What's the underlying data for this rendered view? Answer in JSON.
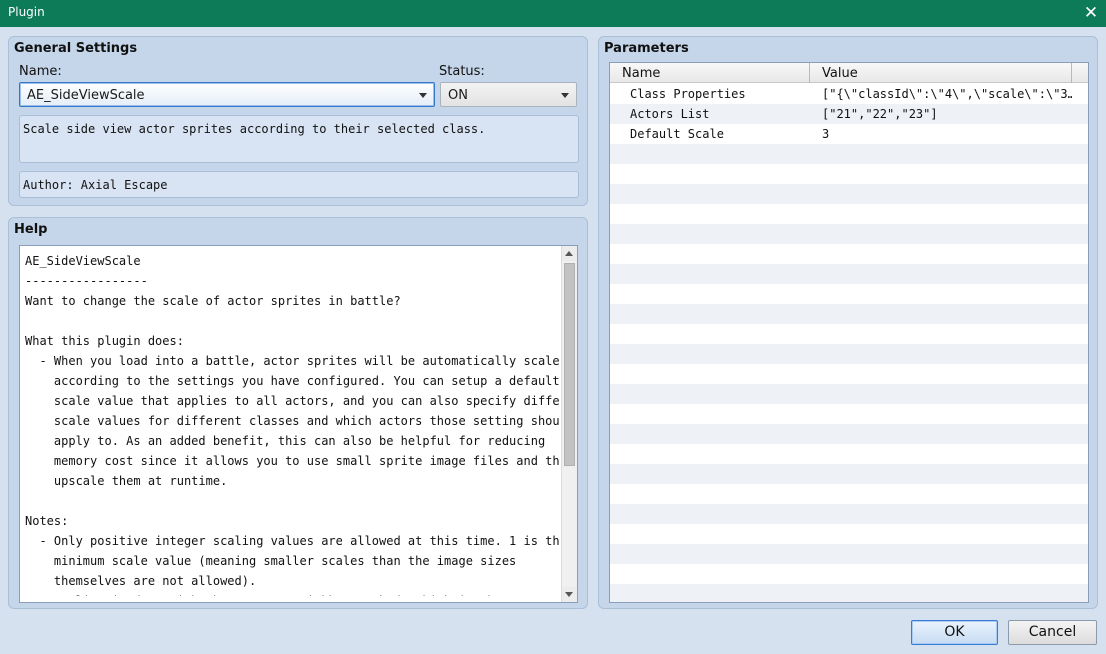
{
  "window": {
    "title": "Plugin"
  },
  "general": {
    "title": "General Settings",
    "name_label": "Name:",
    "name_value": "AE_SideViewScale",
    "status_label": "Status:",
    "status_value": "ON",
    "description": "Scale side view actor sprites according to their selected class.",
    "author": "Author: Axial Escape"
  },
  "help": {
    "title": "Help",
    "text": "AE_SideViewScale\n-----------------\nWant to change the scale of actor sprites in battle?\n\nWhat this plugin does:\n  - When you load into a battle, actor sprites will be automatically scaled\n    according to the settings you have configured. You can setup a default\n    scale value that applies to all actors, and you can also specify different\n    scale values for different classes and which actors those setting should\n    apply to. As an added benefit, this can also be helpful for reducing\n    memory cost since it allows you to use small sprite image files and then\n    upscale them at runtime.\n\nNotes:\n  - Only positive integer scaling values are allowed at this time. 1 is the\n    minimum scale value (meaning smaller scales than the image sizes\n    themselves are not allowed).\n    Scaling is done with the nearest neighbor method, which is what you want"
  },
  "parameters": {
    "title": "Parameters",
    "columns": [
      "Name",
      "Value"
    ],
    "rows": [
      {
        "name": "Class Properties",
        "value": "[\"{\\\"classId\\\":\\\"4\\\",\\\"scale\\\":\\\"3…"
      },
      {
        "name": "Actors List",
        "value": "[\"21\",\"22\",\"23\"]"
      },
      {
        "name": "Default Scale",
        "value": "3"
      }
    ]
  },
  "buttons": {
    "ok": "OK",
    "cancel": "Cancel"
  },
  "colors": {
    "titlebar": "#0e7b58",
    "panel": "#c5d6ea",
    "background": "#d5e1ee",
    "focus": "#3477c8"
  },
  "icons": {
    "close": "close-icon",
    "dropdown": "chevron-down-icon"
  }
}
